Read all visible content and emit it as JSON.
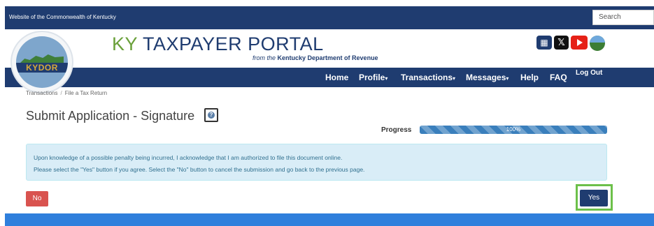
{
  "topbar": {
    "text": "Website of the Commonwealth of Kentucky",
    "search_placeholder": "Search"
  },
  "header": {
    "title_prefix": "KY",
    "title_rest": "TAXPAYER PORTAL",
    "subtitle_italic": "from the",
    "subtitle_rest": "Kentucky Department of Revenue"
  },
  "logo": {
    "text": "KYDOR"
  },
  "social_icons": [
    "calendar-icon",
    "x-icon",
    "youtube-icon",
    "kentucky-map-icon"
  ],
  "nav": {
    "home": "Home",
    "profile": "Profile",
    "transactions": "Transactions",
    "messages": "Messages",
    "help": "Help",
    "faq": "FAQ",
    "logout": "Log Out",
    "caret": "▾"
  },
  "breadcrumb": {
    "items": [
      "Transactions",
      "File a Tax Return"
    ],
    "separator": "/"
  },
  "page": {
    "title": "Submit Application - Signature",
    "help_glyph": "?"
  },
  "progress": {
    "label": "Progress",
    "value": 100,
    "text": "100%"
  },
  "alert": {
    "line1": "Upon knowledge of a possible penalty being incurred, I acknowledge that I am authorized to file this document online.",
    "line2": "Please select the \"Yes\" button if you agree. Select the \"No\" button to cancel the submission and go back to the previous page."
  },
  "buttons": {
    "no": "No",
    "yes": "Yes"
  },
  "colors": {
    "navy": "#1f3c70",
    "green": "#6aa03a",
    "alert_bg": "#d9edf7",
    "no_button": "#d9534f",
    "highlight": "#6cc04a",
    "footer": "#2f7fdc"
  }
}
